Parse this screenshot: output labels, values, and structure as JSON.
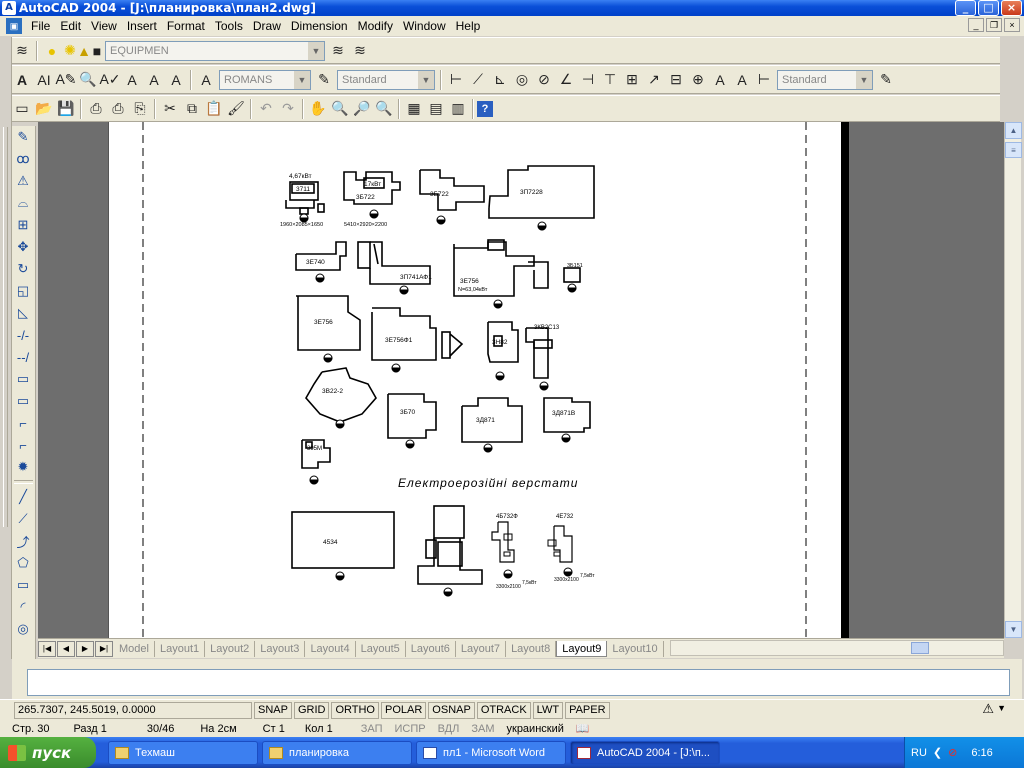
{
  "window": {
    "title": "AutoCAD 2004 - [J:\\планировка\\план2.dwg]",
    "buttons": [
      "_",
      "□",
      "×"
    ]
  },
  "menubar": {
    "items": [
      "File",
      "Edit",
      "View",
      "Insert",
      "Format",
      "Tools",
      "Draw",
      "Dimension",
      "Modify",
      "Window",
      "Help"
    ]
  },
  "toolbar1": {
    "layer_value": "EQUIPMEN"
  },
  "toolbar2": {
    "textstyle_value": "ROMANS",
    "dimstyle_value": "Standard",
    "tablestyle_value": "Standard"
  },
  "drawing": {
    "heading": "Електроерозійні верстати",
    "labels": {
      "m1_top": "4,67кВт",
      "m1_name": "3711",
      "m1_dims": "1960×2085×1650",
      "m2_top": "17кВт",
      "m2_name": "3Б722",
      "m2_dims": "5410×2920×2200",
      "m3": "3Б722",
      "m4": "3П7228",
      "m5": "3Е740",
      "m6": "3П741АФ1",
      "m7_name": "3Е756",
      "m7_power": "N=63,04кВт",
      "m8": "3Б151",
      "m9": "3Е756",
      "m10": "3Е756Ф1",
      "m11": "3Н82",
      "m12": "3КВ2С13",
      "m13": "3В22-2",
      "m14": "3Б70",
      "m15": "3Д871",
      "m16": "3Д871В",
      "m17": "395М",
      "m18": "4534",
      "m19_top": "4Б732Ф",
      "m19_power": "7,5кВт",
      "m19_dims": "3300х2100",
      "m20_top": "4Е732",
      "m20_power": "7,5кВт",
      "m20_dims": "3300х2100"
    }
  },
  "layout_tabs": [
    "Model",
    "Layout1",
    "Layout2",
    "Layout3",
    "Layout4",
    "Layout5",
    "Layout6",
    "Layout7",
    "Layout8",
    "Layout9",
    "Layout10"
  ],
  "active_tab": "Layout9",
  "statusbar": {
    "coords": "265.7307, 245.5019, 0.0000",
    "toggles": [
      "SNAP",
      "GRID",
      "ORTHO",
      "POLAR",
      "OSNAP",
      "OTRACK",
      "LWT",
      "PAPER"
    ]
  },
  "word_status": {
    "page": "Стр. 30",
    "section": "Разд 1",
    "pages": "30/46",
    "at": "На 2см",
    "line": "Ст 1",
    "col": "Кол 1",
    "rec": "ЗАП",
    "trk": "ИСПР",
    "ext": "ВДЛ",
    "ovr": "ЗАМ",
    "lang": "украинский"
  },
  "taskbar": {
    "start_label": "пуск",
    "tasks": [
      "Техмаш",
      "планировка",
      "пл1 - Microsoft Word",
      "AutoCAD 2004 - [J:\\п..."
    ],
    "lang": "RU",
    "clock": "6:16"
  }
}
